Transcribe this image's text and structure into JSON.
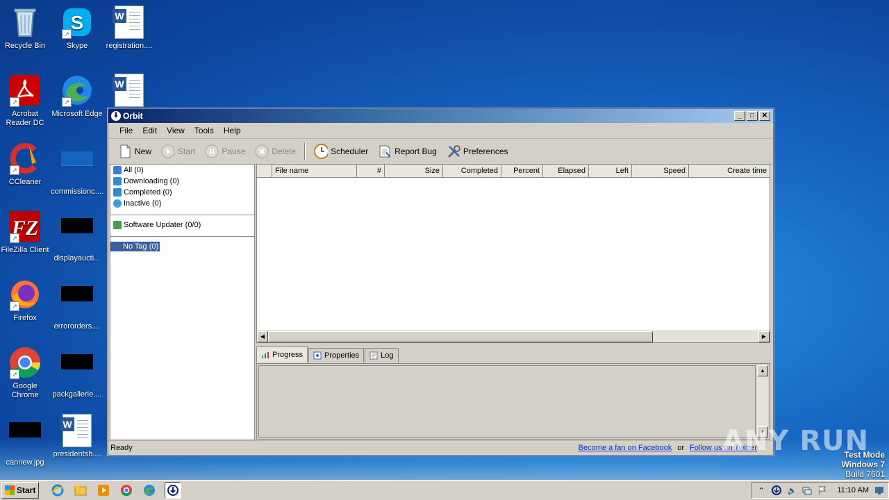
{
  "desktop": {
    "icons": [
      {
        "label": "Recycle Bin",
        "icon": "recycle-bin-icon"
      },
      {
        "label": "Skype",
        "icon": "skype-icon"
      },
      {
        "label": "registration....",
        "icon": "word-document-icon"
      },
      {
        "label": "Acrobat Reader DC",
        "icon": "acrobat-icon"
      },
      {
        "label": "Microsoft Edge",
        "icon": "edge-icon"
      },
      {
        "label": "",
        "icon": "word-document-icon"
      },
      {
        "label": "CCleaner",
        "icon": "ccleaner-icon"
      },
      {
        "label": "commissionc....",
        "icon": "file-thumbnail-icon"
      },
      {
        "label": "FileZilla Client",
        "icon": "filezilla-icon"
      },
      {
        "label": "displayaucti...",
        "icon": "file-thumbnail-icon"
      },
      {
        "label": "Firefox",
        "icon": "firefox-icon"
      },
      {
        "label": "errororders....",
        "icon": "file-thumbnail-icon"
      },
      {
        "label": "Google Chrome",
        "icon": "chrome-icon"
      },
      {
        "label": "packgallerie....",
        "icon": "file-thumbnail-icon"
      },
      {
        "label": "cannew.jpg",
        "icon": "file-thumbnail-icon"
      },
      {
        "label": "presidentsh....",
        "icon": "word-document-icon"
      }
    ]
  },
  "window": {
    "title": "Orbit",
    "menu": [
      "File",
      "Edit",
      "View",
      "Tools",
      "Help"
    ],
    "toolbar": {
      "new": "New",
      "start": "Start",
      "pause": "Pause",
      "delete": "Delete",
      "scheduler": "Scheduler",
      "report_bug": "Report Bug",
      "preferences": "Preferences"
    },
    "categories": [
      {
        "label": "All (0)",
        "color": "#3a7bd5"
      },
      {
        "label": "Downloading (0)",
        "color": "#2e8bd8"
      },
      {
        "label": "Completed (0)",
        "color": "#2e8bd8"
      },
      {
        "label": "Inactive (0)",
        "color": "#3aa0e0"
      }
    ],
    "software_updater": "Software Updater (0/0)",
    "no_tag": "No Tag (0)",
    "columns": [
      "File name",
      "#",
      "Size",
      "Completed",
      "Percent",
      "Elapsed",
      "Left",
      "Speed",
      "Create time"
    ],
    "tabs": [
      "Progress",
      "Properties",
      "Log"
    ],
    "status": "Ready",
    "links": {
      "facebook": "Become a fan on Facebook",
      "or": "or",
      "twitter": "Follow us on Twitter"
    }
  },
  "watermark": {
    "brand": "ANY RUN",
    "line1": "Test Mode",
    "line2": "Windows 7",
    "line3": "Build 7601"
  },
  "taskbar": {
    "start": "Start",
    "clock": "11:10 AM"
  },
  "colors": {
    "accent": "#0a246a",
    "selection": "#3a5fa0",
    "link": "#0033cc"
  }
}
